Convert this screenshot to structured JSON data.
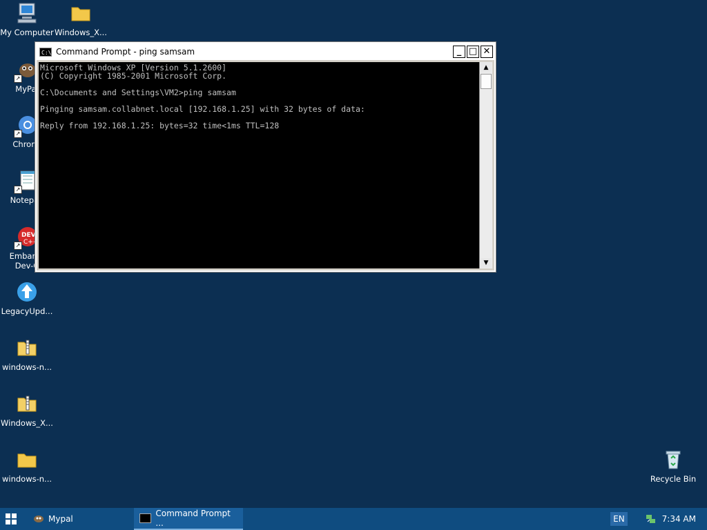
{
  "desktop": {
    "icons": [
      {
        "label": "My Computer",
        "icon": "computer-icon"
      },
      {
        "label": "Windows_X...",
        "icon": "folder-icon"
      },
      {
        "label": "MyPal",
        "icon": "mypal-icon"
      },
      {
        "label": "Chromi",
        "icon": "chromium-icon"
      },
      {
        "label": "Notepad",
        "icon": "notepad-icon"
      },
      {
        "label": "Embarca",
        "label2": "Dev-C",
        "icon": "devcpp-icon"
      },
      {
        "label": "LegacyUpd...",
        "icon": "legacy-update-icon"
      },
      {
        "label": "windows-n...",
        "icon": "zip-folder-icon"
      },
      {
        "label": "Windows_X...",
        "icon": "zip-folder-icon"
      },
      {
        "label": "windows-n...",
        "icon": "folder-icon"
      },
      {
        "label": "Recycle Bin",
        "icon": "recycle-bin-icon"
      }
    ]
  },
  "cmd": {
    "title": "Command Prompt - ping samsam",
    "icon_text": "C:\\",
    "min_label": "_",
    "max_label": "□",
    "close_label": "✕",
    "output": "Microsoft Windows XP [Version 5.1.2600]\n(C) Copyright 1985-2001 Microsoft Corp.\n\nC:\\Documents and Settings\\VM2>ping samsam\n\nPinging samsam.collabnet.local [192.168.1.25] with 32 bytes of data:\n\nReply from 192.168.1.25: bytes=32 time<1ms TTL=128"
  },
  "taskbar": {
    "tasks": [
      {
        "label": "Mypal",
        "active": false
      },
      {
        "label": "Command Prompt ...",
        "active": true
      }
    ],
    "language": "EN",
    "time": "7:34 AM"
  },
  "colors": {
    "desktop_bg": "#0c2f52",
    "taskbar_bg": "#0f4c80",
    "console_fg": "#c0c0c0"
  }
}
